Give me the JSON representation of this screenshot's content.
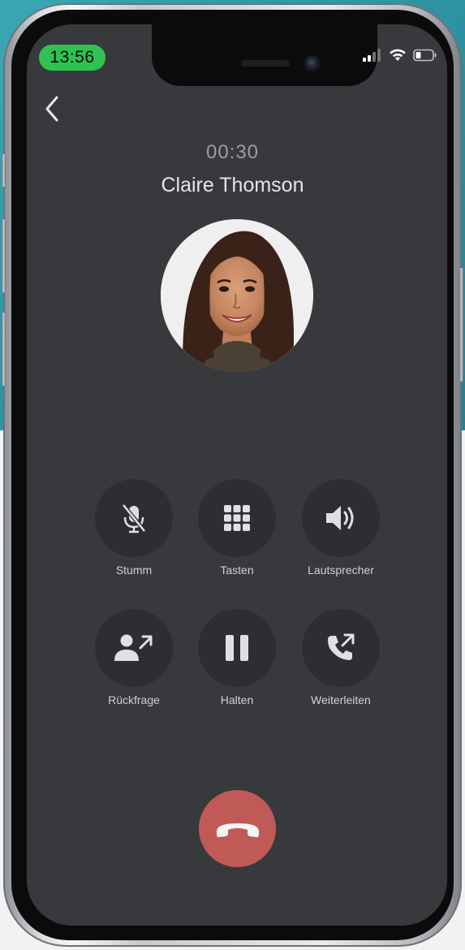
{
  "status_bar": {
    "time": "13:56",
    "icons": [
      "signal-icon",
      "wifi-icon",
      "battery-icon"
    ]
  },
  "call": {
    "timer": "00:30",
    "caller_name": "Claire Thomson"
  },
  "actions": [
    {
      "label": "Stumm",
      "icon": "mic-off-icon"
    },
    {
      "label": "Tasten",
      "icon": "keypad-icon"
    },
    {
      "label": "Lautsprecher",
      "icon": "speaker-icon"
    },
    {
      "label": "Rückfrage",
      "icon": "consult-person-icon"
    },
    {
      "label": "Halten",
      "icon": "pause-icon"
    },
    {
      "label": "Weiterleiten",
      "icon": "forward-call-icon"
    }
  ],
  "colors": {
    "screen_bg": "#38393c",
    "button_bg": "#2d2e31",
    "hangup": "#c05a57",
    "time_pill": "#2fc253"
  }
}
